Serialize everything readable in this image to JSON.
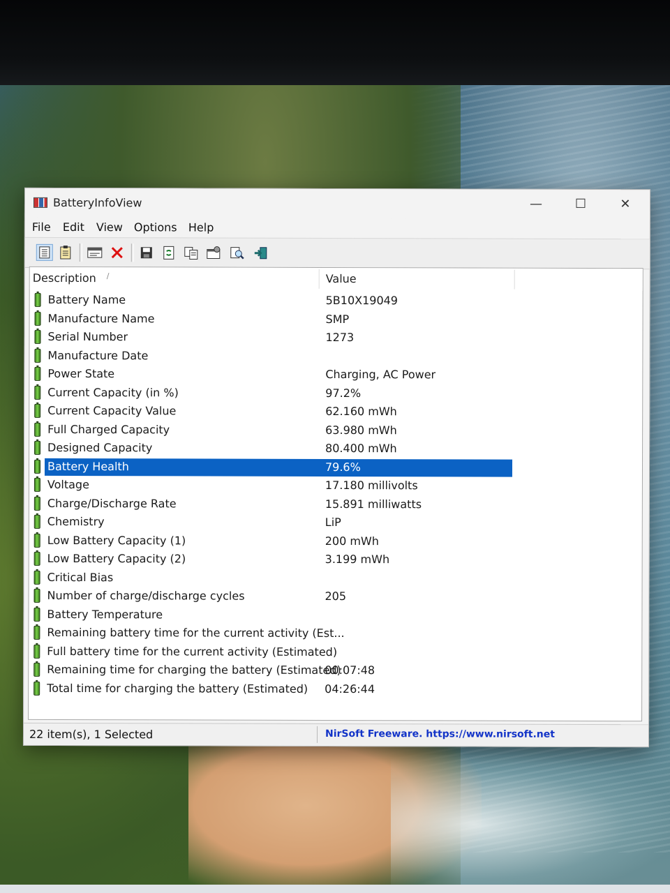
{
  "window": {
    "title": "BatteryInfoView",
    "minimize_label": "—",
    "maximize_label": "☐",
    "close_label": "✕"
  },
  "menu": [
    "File",
    "Edit",
    "View",
    "Options",
    "Help"
  ],
  "toolbar": {
    "buttons": [
      "properties-icon",
      "html-report-icon",
      "battery-log-icon",
      "clear-log-icon",
      "save-icon",
      "refresh-icon",
      "copy-icon",
      "options-icon",
      "find-icon",
      "exit-icon"
    ]
  },
  "columns": {
    "description": "Description",
    "value": "Value"
  },
  "rows": [
    {
      "description": "Battery Name",
      "value": "5B10X19049"
    },
    {
      "description": "Manufacture Name",
      "value": "SMP"
    },
    {
      "description": "Serial Number",
      "value": "1273"
    },
    {
      "description": "Manufacture Date",
      "value": ""
    },
    {
      "description": "Power State",
      "value": "Charging, AC Power"
    },
    {
      "description": "Current Capacity (in %)",
      "value": "97.2%"
    },
    {
      "description": "Current Capacity Value",
      "value": "62.160 mWh"
    },
    {
      "description": "Full Charged Capacity",
      "value": "63.980 mWh"
    },
    {
      "description": "Designed Capacity",
      "value": "80.400 mWh"
    },
    {
      "description": "Battery Health",
      "value": "79.6%",
      "selected": true
    },
    {
      "description": "Voltage",
      "value": "17.180 millivolts"
    },
    {
      "description": "Charge/Discharge Rate",
      "value": "15.891 milliwatts"
    },
    {
      "description": "Chemistry",
      "value": "LiP"
    },
    {
      "description": "Low Battery Capacity (1)",
      "value": "200 mWh"
    },
    {
      "description": "Low Battery Capacity (2)",
      "value": "3.199 mWh"
    },
    {
      "description": "Critical Bias",
      "value": ""
    },
    {
      "description": "Number of charge/discharge cycles",
      "value": "205"
    },
    {
      "description": "Battery Temperature",
      "value": ""
    },
    {
      "description": "Remaining battery time for the current activity (Est...",
      "value": ""
    },
    {
      "description": "Full battery time for the current activity (Estimated)",
      "value": ""
    },
    {
      "description": "Remaining time for charging the battery (Estimated)",
      "value": "00:07:48"
    },
    {
      "description": "Total  time for charging the battery (Estimated)",
      "value": "04:26:44"
    }
  ],
  "status": {
    "items": "22 item(s), 1 Selected",
    "link": "NirSoft Freeware. https://www.nirsoft.net"
  },
  "colors": {
    "selection": "#0b62c4",
    "link": "#1334c8"
  }
}
